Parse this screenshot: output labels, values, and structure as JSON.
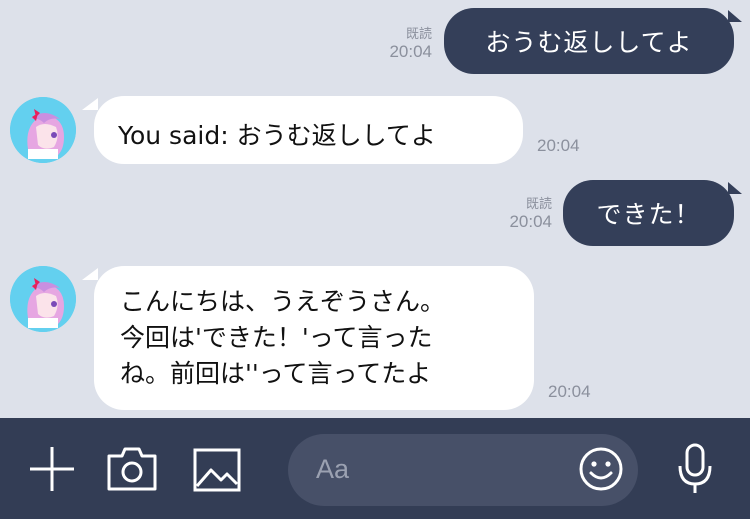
{
  "messages": [
    {
      "side": "out",
      "text": "おうむ返ししてよ",
      "read": "既読",
      "time": "20:04"
    },
    {
      "side": "in",
      "text": "You said: おうむ返ししてよ",
      "time": "20:04"
    },
    {
      "side": "out",
      "text": "できた！",
      "read": "既読",
      "time": "20:04"
    },
    {
      "side": "in",
      "lines": [
        "こんにちは、うえぞうさん。",
        "今回は'できた！'って言った",
        "ね。前回は''って言ってたよ"
      ],
      "time": "20:04"
    }
  ],
  "input": {
    "placeholder": "Aa"
  },
  "toolbar": {
    "icons": [
      "plus-icon",
      "camera-icon",
      "image-icon",
      "emoji-icon",
      "microphone-icon"
    ]
  },
  "colors": {
    "background": "#dde1ea",
    "outgoing_bubble": "#343f59",
    "incoming_bubble": "#ffffff",
    "toolbar": "#333d55",
    "avatar_bg": "#63d0ef"
  }
}
